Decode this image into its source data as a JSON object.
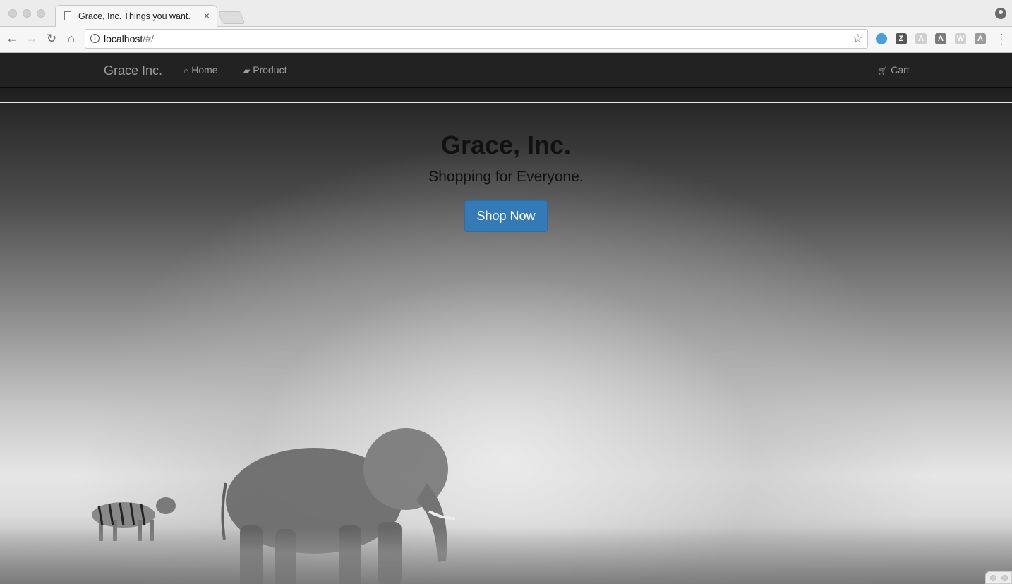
{
  "browser": {
    "tab_title": "Grace, Inc. Things you want.",
    "tab_close": "×",
    "url_host": "localhost",
    "url_path": "/#/",
    "extensions": [
      {
        "name": "search-extension-icon",
        "label": "",
        "color": "#4a9fd8"
      },
      {
        "name": "zotero-extension-icon",
        "label": "Z",
        "color": "#555555"
      },
      {
        "name": "font-extension-icon",
        "label": "A",
        "color": "#cfcfcf"
      },
      {
        "name": "angular-extension-icon",
        "label": "A",
        "color": "#7a7a7a"
      },
      {
        "name": "w-extension-icon",
        "label": "W",
        "color": "#cfcfcf"
      },
      {
        "name": "adblock-extension-icon",
        "label": "A",
        "color": "#9a9a9a"
      }
    ]
  },
  "navbar": {
    "brand": "Grace Inc.",
    "links": [
      {
        "label": "Home",
        "icon": "home-icon"
      },
      {
        "label": "Product",
        "icon": "book-icon"
      }
    ],
    "cart_label": "Cart",
    "cart_icon": "cart-icon"
  },
  "hero": {
    "title": "Grace, Inc.",
    "subtitle": "Shopping for Everyone.",
    "button_label": "Shop Now",
    "button_color": "#337ab7"
  }
}
